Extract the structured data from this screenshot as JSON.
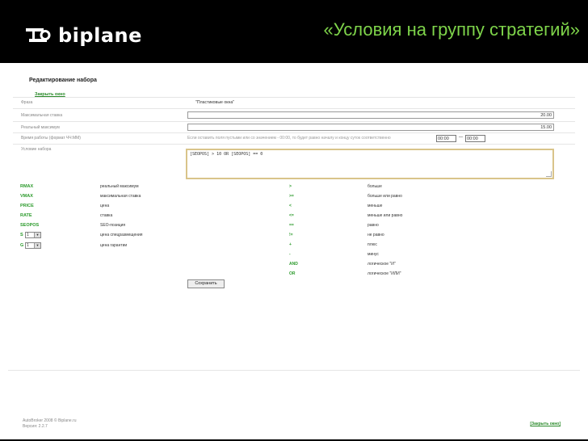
{
  "header": {
    "logo_text": "biplane",
    "slide_title": "«Условия на группу стратегий»"
  },
  "form": {
    "title": "Редактирование набора",
    "close_link": "Закрыть окно",
    "fields": [
      {
        "label": "Фраза",
        "value": "\"Пластиковые окна\""
      },
      {
        "label": "Максимальная ставка",
        "value": "20.00"
      },
      {
        "label": "Реальный максимум",
        "value": "15.00"
      },
      {
        "label": "Время работы (формат ЧЧ:ММ)",
        "hint": "Если оставить поля пустыми или со значением - 00:00, то будет равно началу и концу суток соответственно",
        "from": "00:00",
        "to": "00:00",
        "sep": "—"
      },
      {
        "label": "Условие набора",
        "value": "[SEOPOS] > 10 OR [SEOPOS] == 0"
      }
    ],
    "variables": [
      {
        "name": "RMAX",
        "desc": "реальный максимум"
      },
      {
        "name": "VMAX",
        "desc": "максимальная ставка"
      },
      {
        "name": "PRICE",
        "desc": "цена"
      },
      {
        "name": "RATE",
        "desc": "ставка"
      },
      {
        "name": "SEOPOS",
        "desc": "SEO-позиция"
      },
      {
        "name": "S",
        "select": "1",
        "desc": "цена спецразмещения"
      },
      {
        "name": "G",
        "select": "1",
        "desc": "цена гарантии"
      }
    ],
    "operators": [
      {
        "op": ">",
        "desc": "больше"
      },
      {
        "op": ">=",
        "desc": "больше или равно"
      },
      {
        "op": "<",
        "desc": "меньше"
      },
      {
        "op": "<=",
        "desc": "меньше или равно"
      },
      {
        "op": "==",
        "desc": "равно"
      },
      {
        "op": "!=",
        "desc": "не равно"
      },
      {
        "op": "+",
        "desc": "плюс"
      },
      {
        "op": "-",
        "desc": "минус"
      },
      {
        "op": "AND",
        "desc": "логическое \"И\""
      },
      {
        "op": "OR",
        "desc": "логическое \"ИЛИ\""
      }
    ],
    "save_label": "Сохранить"
  },
  "footer": {
    "line1": "AutoBroker 2008 © Biplane.ru",
    "line2": "Версия: 2.2.7",
    "close_link": "[Закрыть окно]"
  },
  "colors": {
    "accent": "#7ed44a",
    "link": "#2a8a2a",
    "background": "#000000"
  }
}
